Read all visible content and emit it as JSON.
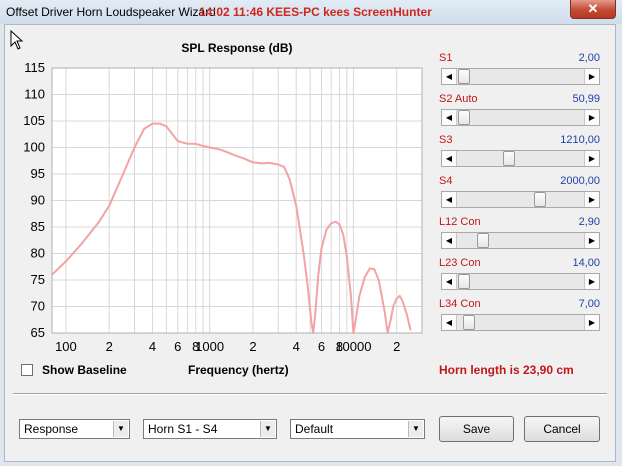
{
  "window": {
    "title": "Offset Driver Horn Loudspeaker Wizard",
    "title_overlay": "14:02 11:46 KEES-PC kees ScreenHunter",
    "close_label": "✕"
  },
  "chart_data": {
    "type": "line",
    "title": "SPL Response (dB)",
    "xlabel": "Frequency (hertz)",
    "ylabel": "",
    "x_scale": "log",
    "xlim": [
      80,
      30000
    ],
    "ylim": [
      65,
      115
    ],
    "y_ticks": [
      115,
      110,
      105,
      100,
      95,
      90,
      85,
      80,
      75,
      70,
      65
    ],
    "x_tick_labels": [
      {
        "x": 100,
        "label": "100"
      },
      {
        "x": 200,
        "label": "2"
      },
      {
        "x": 400,
        "label": "4"
      },
      {
        "x": 600,
        "label": "6"
      },
      {
        "x": 800,
        "label": "8"
      },
      {
        "x": 1000,
        "label": "1000"
      },
      {
        "x": 2000,
        "label": "2"
      },
      {
        "x": 4000,
        "label": "4"
      },
      {
        "x": 6000,
        "label": "6"
      },
      {
        "x": 8000,
        "label": "8"
      },
      {
        "x": 10000,
        "label": "10000"
      },
      {
        "x": 20000,
        "label": "2"
      }
    ],
    "grid": true,
    "series_color": "#f2a3a3",
    "series": [
      {
        "points": [
          [
            80,
            76
          ],
          [
            100,
            78.5
          ],
          [
            130,
            82
          ],
          [
            170,
            86
          ],
          [
            200,
            89
          ],
          [
            250,
            95
          ],
          [
            300,
            100
          ],
          [
            350,
            103.5
          ],
          [
            400,
            104.5
          ],
          [
            450,
            104.5
          ],
          [
            500,
            104
          ],
          [
            550,
            102.5
          ],
          [
            600,
            101.2
          ],
          [
            700,
            100.7
          ],
          [
            800,
            100.7
          ],
          [
            900,
            100.3
          ],
          [
            1000,
            100
          ],
          [
            1150,
            99.7
          ],
          [
            1300,
            99.2
          ],
          [
            1500,
            98.5
          ],
          [
            1700,
            98
          ],
          [
            2000,
            97.2
          ],
          [
            2300,
            97
          ],
          [
            2600,
            97.1
          ],
          [
            3000,
            96.8
          ],
          [
            3300,
            96.3
          ],
          [
            3600,
            94
          ],
          [
            4000,
            89
          ],
          [
            4500,
            80
          ],
          [
            4800,
            74
          ],
          [
            5100,
            67
          ],
          [
            5250,
            65
          ],
          [
            5400,
            68
          ],
          [
            5700,
            76
          ],
          [
            6000,
            81
          ],
          [
            6500,
            84.5
          ],
          [
            7000,
            85.7
          ],
          [
            7500,
            86
          ],
          [
            8000,
            85.5
          ],
          [
            8500,
            83.5
          ],
          [
            9000,
            79.5
          ],
          [
            9600,
            72
          ],
          [
            10000,
            65
          ],
          [
            10300,
            67
          ],
          [
            11000,
            72
          ],
          [
            12000,
            75.5
          ],
          [
            13000,
            77.2
          ],
          [
            14000,
            77
          ],
          [
            15000,
            75
          ],
          [
            16500,
            69
          ],
          [
            17300,
            65
          ],
          [
            18000,
            67
          ],
          [
            19000,
            70.2
          ],
          [
            20000,
            71.5
          ],
          [
            21000,
            72
          ],
          [
            22000,
            71
          ],
          [
            23500,
            68.5
          ],
          [
            25000,
            65.5
          ]
        ]
      }
    ]
  },
  "baseline": {
    "label": "Show Baseline",
    "checked": false
  },
  "params": [
    {
      "name": "S1",
      "value": "2,00",
      "pos": 0.0
    },
    {
      "name": "S2  Auto",
      "value": "50,99",
      "pos": 0.0
    },
    {
      "name": "S3",
      "value": "1210,00",
      "pos": 0.4
    },
    {
      "name": "S4",
      "value": "2000,00",
      "pos": 0.67
    },
    {
      "name": "L12  Con",
      "value": "2,90",
      "pos": 0.17
    },
    {
      "name": "L23  Con",
      "value": "14,00",
      "pos": 0.0
    },
    {
      "name": "L34  Con",
      "value": "7,00",
      "pos": 0.04
    }
  ],
  "horn_length": "Horn length is 23,90 cm",
  "combos": {
    "view": "Response",
    "section": "Horn S1 - S4",
    "preset": "Default"
  },
  "buttons": {
    "save": "Save",
    "cancel": "Cancel"
  },
  "colors": {
    "param_name": "#c0171a",
    "param_value": "#1f3fa8",
    "accent_red": "#c0171a"
  },
  "icons": {
    "cursor": "mouse-pointer-icon",
    "scroll_left": "arrow-left-icon",
    "scroll_right": "arrow-right-icon",
    "dropdown": "chevron-down-icon"
  }
}
